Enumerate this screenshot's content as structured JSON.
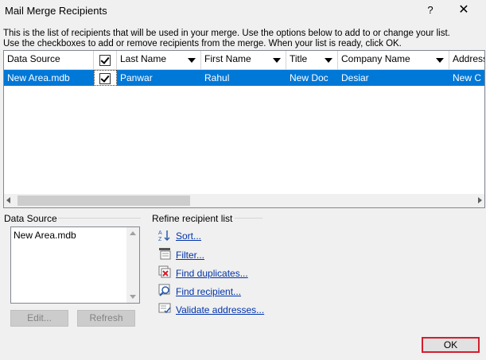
{
  "window": {
    "title": "Mail Merge Recipients",
    "help_label": "?",
    "close_label": "✕"
  },
  "instructions": {
    "line1": "This is the list of recipients that will be used in your merge.  Use the options below to add to or change your list.",
    "line2": "Use the checkboxes to add or remove recipients from the merge.  When your list is ready, click OK."
  },
  "grid": {
    "columns": [
      "Data Source",
      "",
      "Last Name",
      "First Name",
      "Title",
      "Company Name",
      "Address"
    ],
    "rows": [
      {
        "data_source": "New Area.mdb",
        "checked": true,
        "last_name": "Panwar",
        "first_name": "Rahul",
        "title": "New Doc",
        "company": "Desiar",
        "address": "New C"
      }
    ]
  },
  "data_source_panel": {
    "label": "Data Source",
    "items": [
      "New Area.mdb"
    ],
    "edit_label": "Edit...",
    "refresh_label": "Refresh"
  },
  "refine_panel": {
    "label": "Refine recipient list",
    "links": [
      {
        "label": "Sort...",
        "icon": "sort-az-icon"
      },
      {
        "label": "Filter...",
        "icon": "filter-icon"
      },
      {
        "label": "Find duplicates...",
        "icon": "find-duplicates-icon"
      },
      {
        "label": "Find recipient...",
        "icon": "find-recipient-icon"
      },
      {
        "label": "Validate addresses...",
        "icon": "validate-addresses-icon"
      }
    ]
  },
  "footer": {
    "ok_label": "OK"
  },
  "colors": {
    "selection": "#0078d7",
    "link": "#0033aa",
    "ok_highlight": "#d21f2e"
  }
}
